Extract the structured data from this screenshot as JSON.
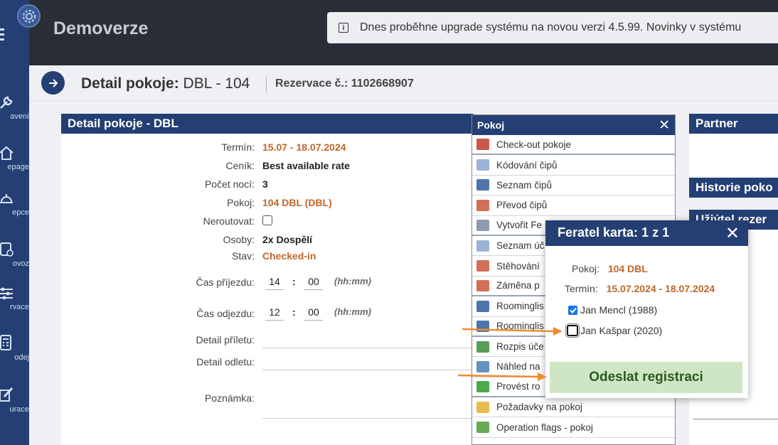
{
  "app": {
    "brand": "Demoverze",
    "notice": "Dnes proběhne upgrade systému na novou verzi 4.5.99. Novinky v systému"
  },
  "sidebar": {
    "items": [
      {
        "label": "avení",
        "icon": "wrench-icon"
      },
      {
        "label": "epage",
        "icon": "house-icon"
      },
      {
        "label": "epce",
        "icon": "bell-icon"
      },
      {
        "label": "ovoz",
        "icon": "clipboard-icon"
      },
      {
        "label": "rvace",
        "icon": "sliders-icon"
      },
      {
        "label": "odej",
        "icon": "calculator-icon"
      },
      {
        "label": "urace",
        "icon": "edit-icon"
      }
    ]
  },
  "header": {
    "title_bold": "Detail pokoje:",
    "title_room": "DBL - 104",
    "reservation": "Rezervace č.: 1102668907"
  },
  "detail": {
    "panel_title": "Detail pokoje - DBL",
    "term_label": "Termín:",
    "term_value": "15.07 - 18.07.2024",
    "pricelist_label": "Ceník:",
    "pricelist_value": "Best available rate",
    "nights_label": "Počet nocí:",
    "nights_value": "3",
    "room_label": "Pokoj:",
    "room_value": "104 DBL (DBL)",
    "noroute_label": "Neroutovat:",
    "persons_label": "Osoby:",
    "persons_value": "2x Dospělí",
    "status_label": "Stav:",
    "status_value": "Checked-in",
    "arrival_label": "Čas příjezdu:",
    "arrival_h": "14",
    "arrival_m": "00",
    "departure_label": "Čas odjezdu:",
    "departure_h": "12",
    "departure_m": "00",
    "time_hint": "(hh:mm)",
    "colon": ":",
    "flight_in_label": "Detail příletu:",
    "flight_out_label": "Detail odletu:",
    "note_label": "Poznámka:"
  },
  "menu": {
    "title": "Pokoj",
    "close": "✕",
    "items": [
      {
        "label": "Check-out pokoje",
        "icon": "checkout-icon",
        "color": "#c0392b"
      },
      {
        "label": "Kódování čipů",
        "icon": "tag-icon",
        "color": "#8aa6cf"
      },
      {
        "label": "Seznam čipů",
        "icon": "book-icon",
        "color": "#2f5d9e"
      },
      {
        "label": "Převod čipů",
        "icon": "transfer-icon",
        "color": "#c9563c"
      },
      {
        "label": "Vytvořit Fe",
        "icon": "card-icon",
        "color": "#7a8aa0"
      },
      {
        "label": "Seznam úč",
        "icon": "list-icon",
        "color": "#8aa6cf"
      },
      {
        "label": "Stěhování",
        "icon": "move-icon",
        "color": "#c9563c"
      },
      {
        "label": "Záměna p",
        "icon": "swap-icon",
        "color": "#c9563c"
      },
      {
        "label": "Roominglis",
        "icon": "book-icon",
        "color": "#2f5d9e"
      },
      {
        "label": "Roominglis",
        "icon": "book-icon",
        "color": "#2f5d9e"
      },
      {
        "label": "Rozpis úče",
        "icon": "people-icon",
        "color": "#3d8a3d"
      },
      {
        "label": "Náhled na",
        "icon": "preview-icon",
        "color": "#4a7fb5"
      },
      {
        "label": "Provést ro",
        "icon": "check-icon",
        "color": "#2e9a2e"
      },
      {
        "label": "Požadavky na pokoj",
        "icon": "bulb-icon",
        "color": "#e0b030"
      },
      {
        "label": "Operation flags - pokoj",
        "icon": "flag-icon",
        "color": "#4c9a3a"
      }
    ]
  },
  "right": {
    "partner_title": "Partner",
    "history_title": "Historie poko",
    "third_title": "Uživ́tel rezer"
  },
  "popup": {
    "title": "Feratel karta: 1 z 1",
    "close": "✕",
    "room_label": "Pokoj:",
    "room_value": "104 DBL",
    "term_label": "Termín:",
    "term_value": "15.07.2024 - 18.07.2024",
    "guests": [
      {
        "name": "Jan Mencl (1988)",
        "checked": true
      },
      {
        "name": "Jan Kašpar (2020)",
        "checked": false
      }
    ],
    "send_label": "Odeslat registraci"
  },
  "colors": {
    "navy": "#243f73",
    "accent_orange": "#c0662a",
    "arrow_orange": "#f08a2c",
    "send_bg": "#cfe6c4",
    "send_text": "#2a5a1e"
  }
}
